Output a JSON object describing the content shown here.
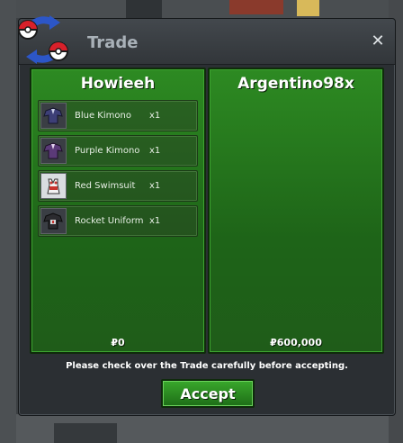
{
  "window": {
    "title": "Trade",
    "close_icon": "close-icon"
  },
  "left_trader": {
    "name": "Howieeh",
    "money": "₽0",
    "items": [
      {
        "name": "Blue Kimono",
        "qty": "x1",
        "icon": "blue-kimono-icon",
        "color": "#3d3f77"
      },
      {
        "name": "Purple Kimono",
        "qty": "x1",
        "icon": "purple-kimono-icon",
        "color": "#5b3a78"
      },
      {
        "name": "Red Swimsuit",
        "qty": "x1",
        "icon": "red-swimsuit-icon",
        "color": "#c8332e"
      },
      {
        "name": "Rocket Uniform",
        "qty": "x1",
        "icon": "rocket-uniform-icon",
        "color": "#2b2b2f"
      }
    ]
  },
  "right_trader": {
    "name": "Argentino98x",
    "money": "₽600,000",
    "items": []
  },
  "notice": "Please check over the Trade carefully before accepting.",
  "accept_label": "Accept",
  "colors": {
    "panel": "#1e6418",
    "accent": "#39a82c",
    "window": "#2b2f33"
  }
}
